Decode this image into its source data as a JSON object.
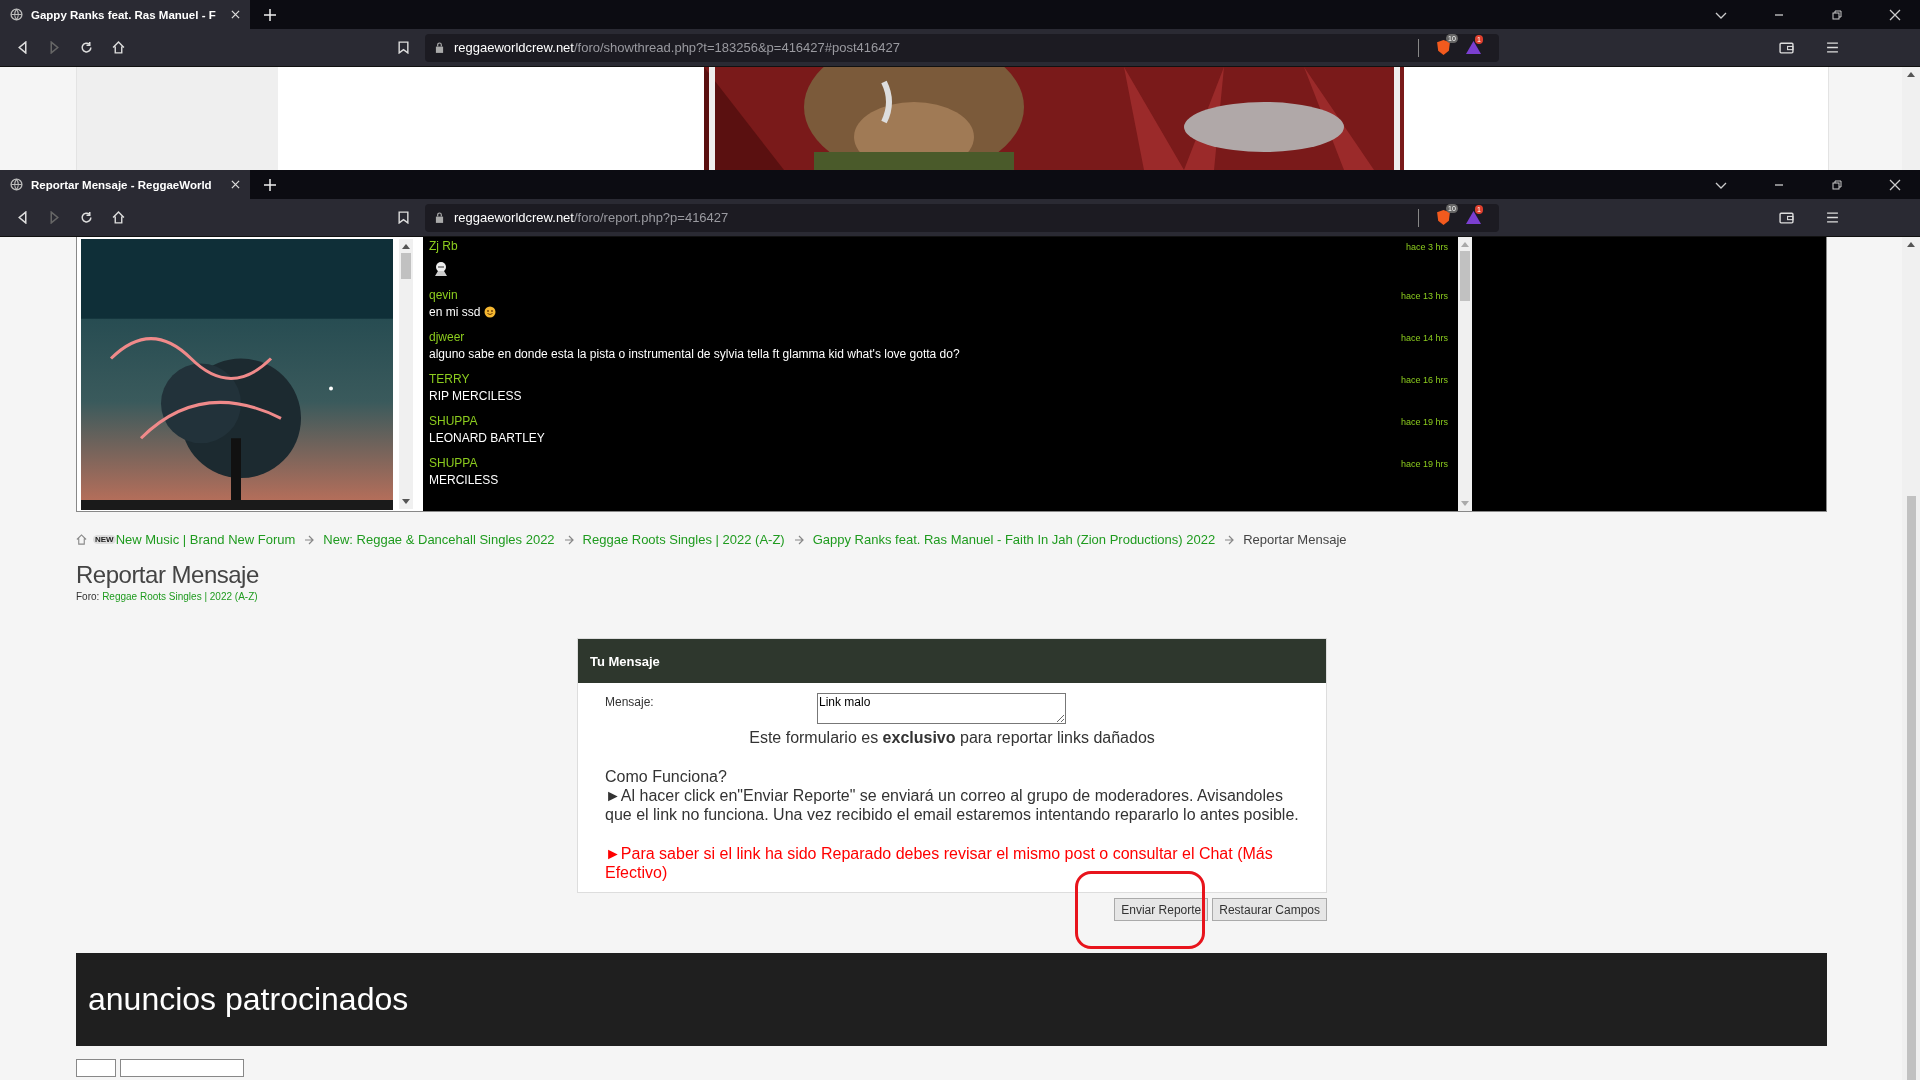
{
  "browsers": [
    {
      "tab_title": "Gappy Ranks feat. Ras Manuel - F",
      "url_host": "reggaeworldcrew.net",
      "url_path": "/foro/showthread.php?t=183256&p=416427#post416427",
      "shield_count": "10",
      "alert_count": "1"
    },
    {
      "tab_title": "Reportar Mensaje - ReggaeWorld",
      "url_host": "reggaeworldcrew.net",
      "url_path": "/foro/report.php?p=416427",
      "shield_count": "10",
      "alert_count": "1"
    }
  ],
  "chat": {
    "messages": [
      {
        "user": "Zj Rb",
        "time": "hace 3 hrs",
        "kind": "sticker"
      },
      {
        "user": "qevin",
        "time": "hace 13 hrs",
        "kind": "text",
        "text": "en mi ssd",
        "emoji": true
      },
      {
        "user": "djweer",
        "time": "hace 14 hrs",
        "kind": "text",
        "text": "alguno sabe en donde esta la pista o instrumental de sylvia tella ft glamma kid what's love gotta do?",
        "emoji": false
      },
      {
        "user": "TERRY",
        "time": "hace 16 hrs",
        "kind": "text",
        "text": "RIP MERCILESS",
        "emoji": false
      },
      {
        "user": "SHUPPA",
        "time": "hace 19 hrs",
        "kind": "text",
        "text": "LEONARD BARTLEY",
        "emoji": false
      },
      {
        "user": "SHUPPA",
        "time": "hace 19 hrs",
        "kind": "text",
        "text": "MERCILESS",
        "emoji": false
      }
    ]
  },
  "breadcrumb": {
    "badge": "NEW",
    "items": [
      "New Music | Brand New Forum",
      "New: Reggae & Dancehall Singles 2022",
      "Reggae Roots Singles | 2022 (A-Z)",
      "Gappy Ranks feat. Ras Manuel - Faith In Jah (Zion Productions) 2022"
    ],
    "current": "Reportar Mensaje"
  },
  "page_title": "Reportar Mensaje",
  "forum": {
    "label": "Foro:",
    "link": "Reggae Roots Singles | 2022 (A-Z)"
  },
  "form": {
    "header": "Tu Mensaje",
    "field_label": "Mensaje:",
    "field_value": "Link malo",
    "notice": "Este formulario es **exclusivo** para reportar links dañados",
    "how_title": "Como Funciona?",
    "how_text": "►Al hacer click en\"Enviar Reporte\" se enviará un correo al grupo de moderadores. Avisandoles que el link no funciona. Una vez recibido el email estaremos intentando repararlo lo antes posible.",
    "warning": "►Para saber si el link ha sido Reparado debes revisar el mismo post o consultar el Chat (Más Efectivo)",
    "buttons": [
      "Enviar Reporte",
      "Restaurar Campos"
    ]
  },
  "ads_title": "anuncios patrocinados"
}
